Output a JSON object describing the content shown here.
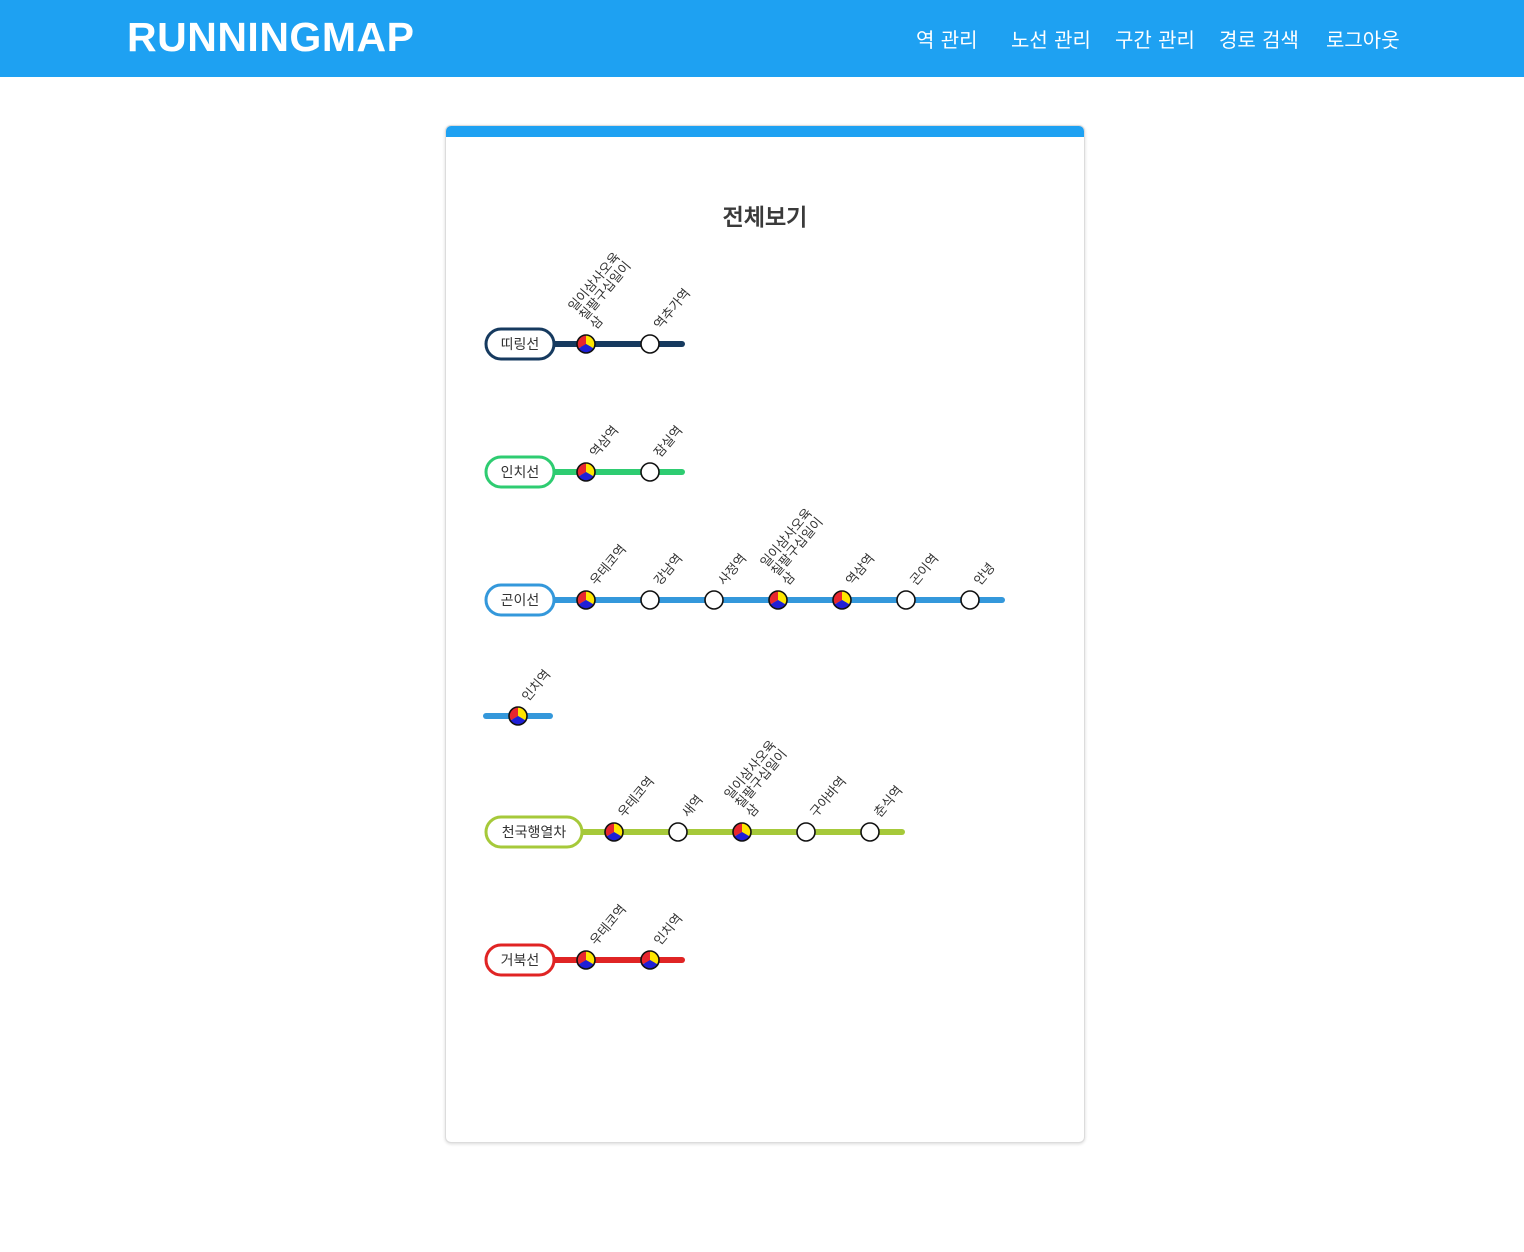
{
  "header": {
    "brand": "RUNNINGMAP",
    "nav": [
      {
        "label": "역 관리",
        "icon": "",
        "name": "nav-station-manage"
      },
      {
        "label": "노선 관리",
        "name": "nav-line-manage"
      },
      {
        "label": "구간 관리",
        "name": "nav-section-manage"
      },
      {
        "label": "경로 검색",
        "name": "nav-path-search"
      },
      {
        "label": "로그아웃",
        "name": "nav-logout"
      }
    ]
  },
  "colors": {
    "header_bg": "#1ea1f2",
    "transfer_red": "#e8262e",
    "transfer_yellow": "#ffe600",
    "transfer_blue": "#1f1fd6"
  },
  "map": {
    "title": "전체보기",
    "lines": [
      {
        "name": "띠링선",
        "color": "#163a5f",
        "show_label": true,
        "stations": [
          {
            "label": "일이삼사오육칠팔구십일이삼",
            "transfer": true
          },
          {
            "label": "역추가역",
            "transfer": false
          }
        ]
      },
      {
        "name": "인치선",
        "color": "#2ecc71",
        "show_label": true,
        "stations": [
          {
            "label": "역삼역",
            "transfer": true
          },
          {
            "label": "잠실역",
            "transfer": false
          }
        ]
      },
      {
        "name": "곤이선",
        "color": "#3498db",
        "show_label": true,
        "stations": [
          {
            "label": "우테코역",
            "transfer": true
          },
          {
            "label": "강남역",
            "transfer": false
          },
          {
            "label": "사정역",
            "transfer": false
          },
          {
            "label": "일이삼사오육칠팔구십일이삼",
            "transfer": true
          },
          {
            "label": "역삼역",
            "transfer": true
          },
          {
            "label": "곤이역",
            "transfer": false
          },
          {
            "label": "안녕",
            "transfer": false
          }
        ]
      },
      {
        "name": "",
        "color": "#3498db",
        "show_label": false,
        "stations": [
          {
            "label": "인치역",
            "transfer": true
          }
        ]
      },
      {
        "name": "천국행열차",
        "color": "#a6c93a",
        "show_label": true,
        "stations": [
          {
            "label": "우테코역",
            "transfer": true
          },
          {
            "label": "새역",
            "transfer": false
          },
          {
            "label": "일이삼사오육칠팔구십일이삼",
            "transfer": true
          },
          {
            "label": "구아바역",
            "transfer": false
          },
          {
            "label": "춘식역",
            "transfer": false
          }
        ]
      },
      {
        "name": "거북선",
        "color": "#e02424",
        "show_label": true,
        "stations": [
          {
            "label": "우테코역",
            "transfer": true
          },
          {
            "label": "인치역",
            "transfer": true
          }
        ]
      }
    ]
  }
}
